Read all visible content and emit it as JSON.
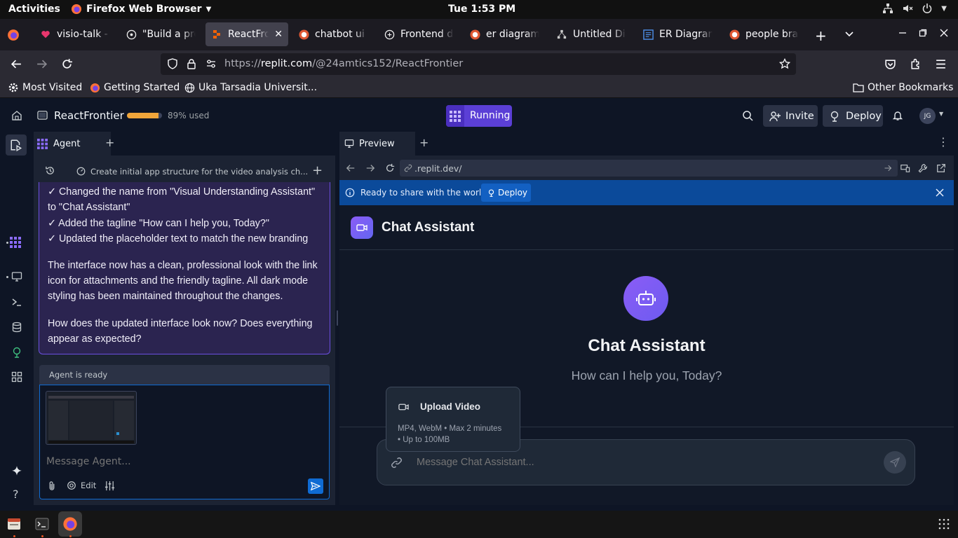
{
  "os": {
    "activities": "Activities",
    "app_name": "Firefox Web Browser",
    "clock": "Tue  1:53 PM"
  },
  "browser": {
    "tabs": [
      {
        "title": "visio-talk - L",
        "icon": "heart-icon"
      },
      {
        "title": "\"Build a pro",
        "icon": "chatgpt-icon"
      },
      {
        "title": "ReactFron",
        "icon": "replit-icon",
        "active": true
      },
      {
        "title": "chatbot ui d",
        "icon": "duckduckgo-icon"
      },
      {
        "title": "Frontend de",
        "icon": "openai-icon"
      },
      {
        "title": "er diagram f",
        "icon": "duckduckgo-icon"
      },
      {
        "title": "Untitled Dia",
        "icon": "drawio-icon"
      },
      {
        "title": "ER Diagram",
        "icon": "diagram-icon"
      },
      {
        "title": "people brae",
        "icon": "duckduckgo-icon"
      }
    ],
    "url_prefix": "https://",
    "url_host": "replit.com",
    "url_path": "/@24amtics152/ReactFrontier",
    "bookmarks": [
      "Most Visited",
      "Getting Started",
      "Uka Tarsadia Universit...",
      "Other Bookmarks"
    ]
  },
  "replit": {
    "repl_name": "ReactFrontier",
    "usage_text": "89% used",
    "usage_percent": 89,
    "run_label": "Running",
    "invite_label": "Invite",
    "deploy_label": "Deploy",
    "avatar_initials": "JG",
    "agent": {
      "tab_label": "Agent",
      "checkpoint_title": "Create initial app structure for the video analysis ch...",
      "bullets": [
        "✓ Changed the name from \"Visual Understanding Assistant\" to \"Chat Assistant\"",
        "✓ Added the tagline \"How can I help you, Today?\"",
        "✓ Updated the placeholder text to match the new branding"
      ],
      "paragraph1": "The interface now has a clean, professional look with the link icon for attachments and the friendly tagline. All dark mode styling has been maintained throughout the changes.",
      "paragraph2": "How does the updated interface look now? Does everything appear as expected?",
      "status": "Agent is ready",
      "input_placeholder": "Message Agent...",
      "edit_label": "Edit"
    },
    "preview": {
      "tab_label": "Preview",
      "url": ".replit.dev/",
      "banner_text": "Ready to share with the world?",
      "banner_deploy": "Deploy",
      "app_title": "Chat Assistant",
      "hero_title": "Chat Assistant",
      "tagline": "How can I help you, Today?",
      "upload_title": "Upload Video",
      "upload_line1": "MP4, WebM • Max 2 minutes",
      "upload_line2": "• Up to 100MB",
      "chat_placeholder": "Message Chat Assistant..."
    }
  }
}
